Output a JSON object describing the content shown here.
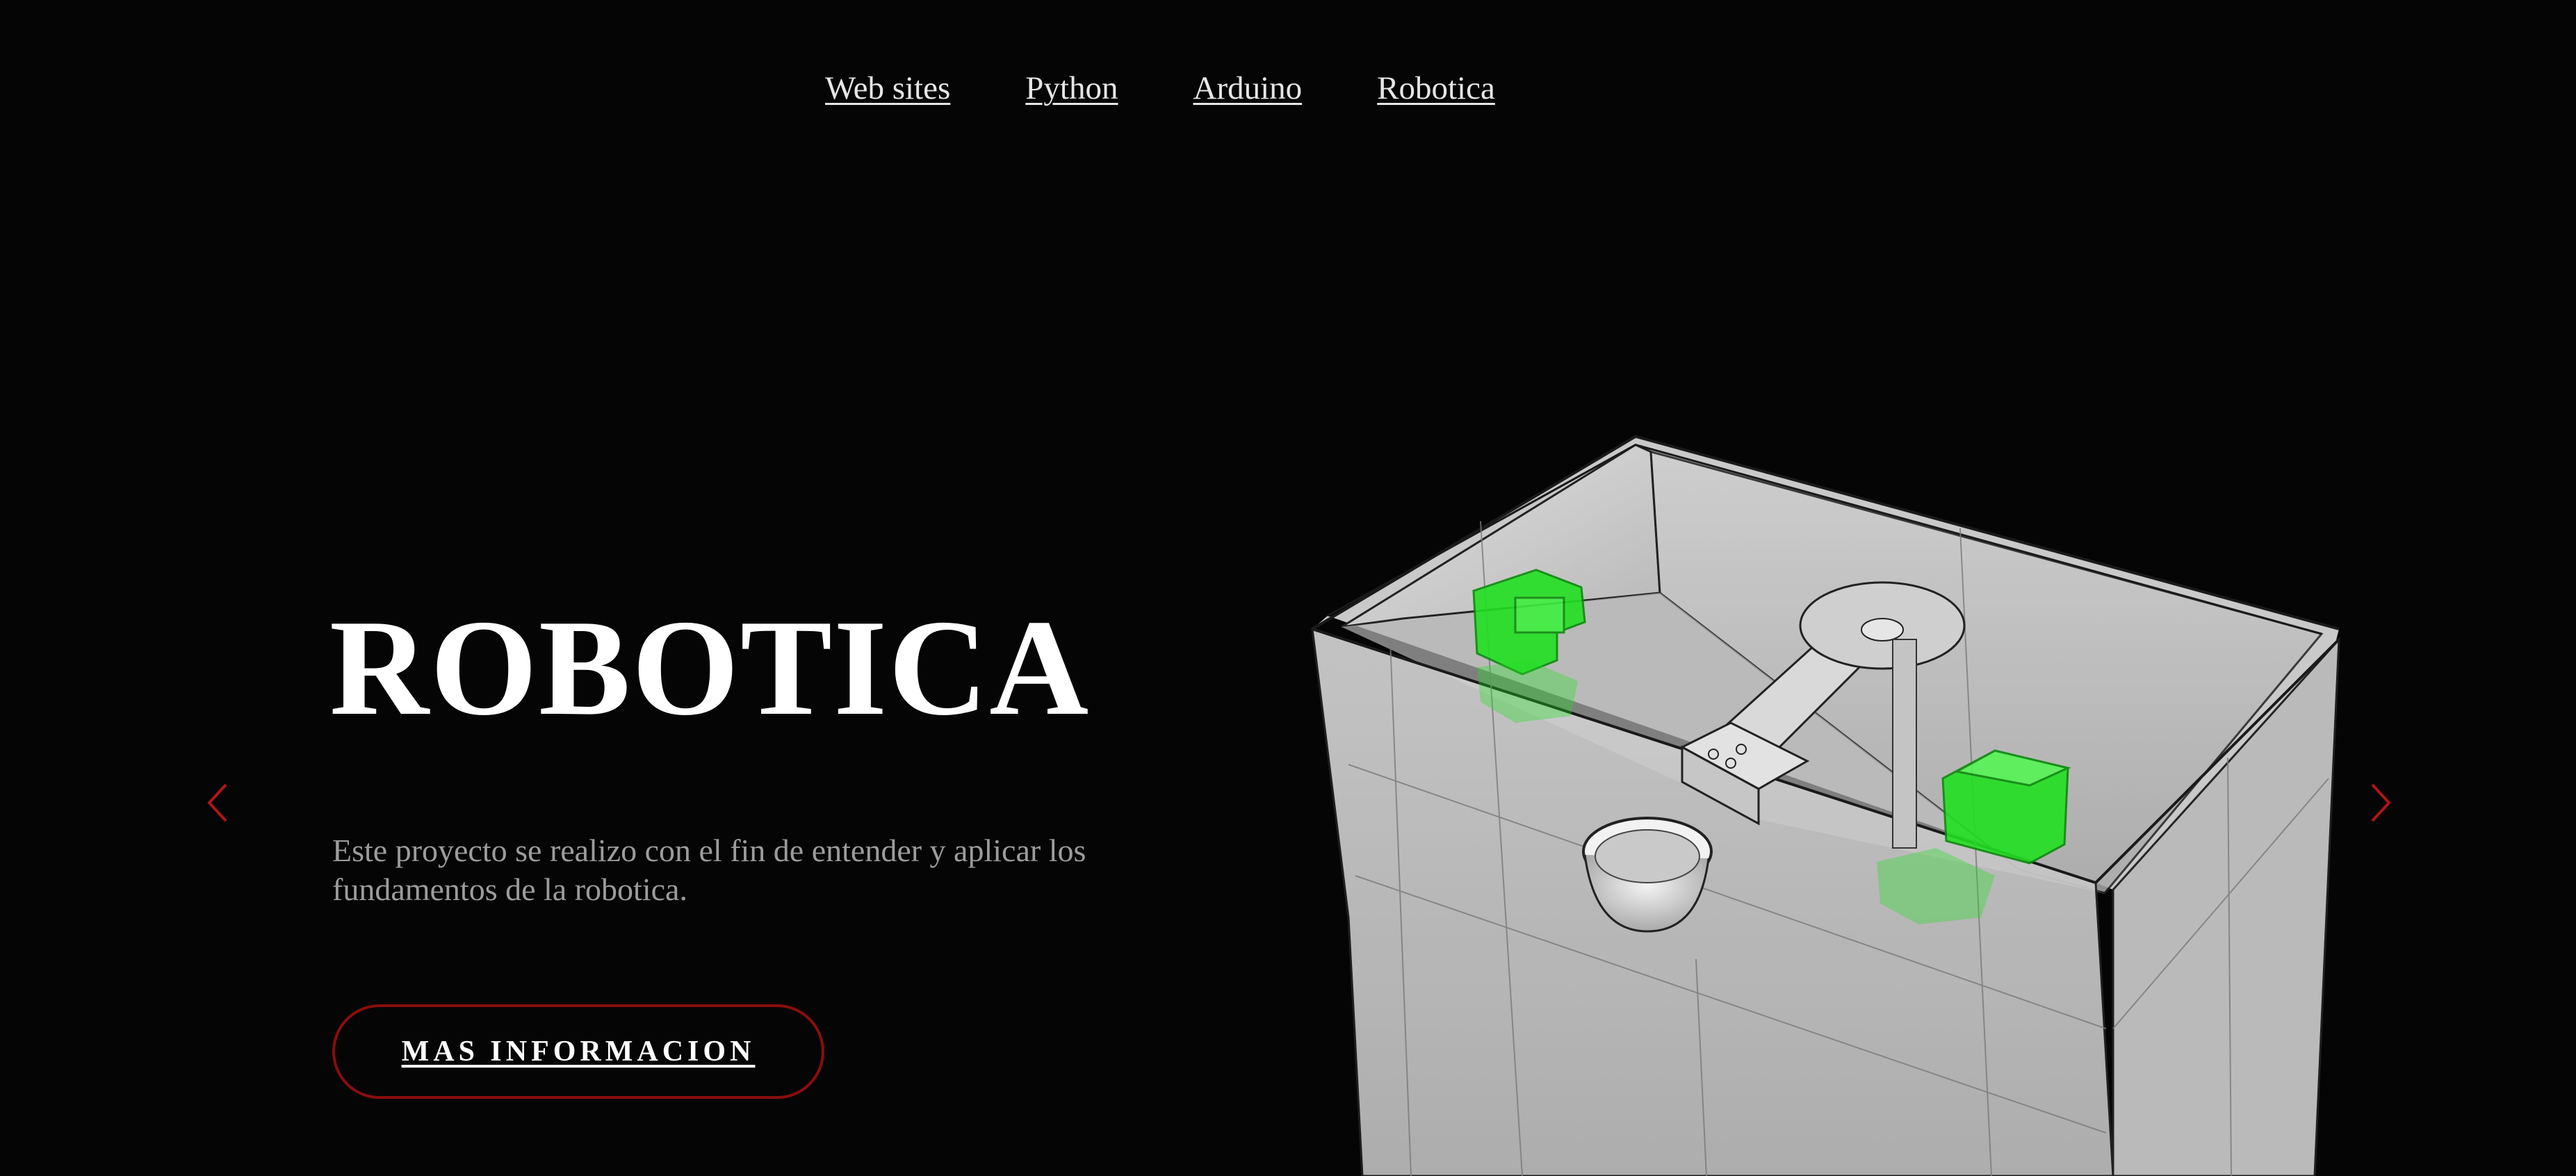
{
  "nav": {
    "items": [
      {
        "label": "Web sites"
      },
      {
        "label": "Python"
      },
      {
        "label": "Arduino"
      },
      {
        "label": "Robotica"
      }
    ]
  },
  "hero": {
    "title": "ROBOTICA",
    "description": "Este proyecto se realizo con el fin de entender y aplicar los fundamentos de la robotica.",
    "cta_label": "MAS INFORMACION"
  },
  "carousel": {
    "prev_icon": "chevron-left-icon",
    "next_icon": "chevron-right-icon"
  },
  "colors": {
    "background": "#050505",
    "accent": "#8a0d0d",
    "component_green": "#22e022"
  }
}
